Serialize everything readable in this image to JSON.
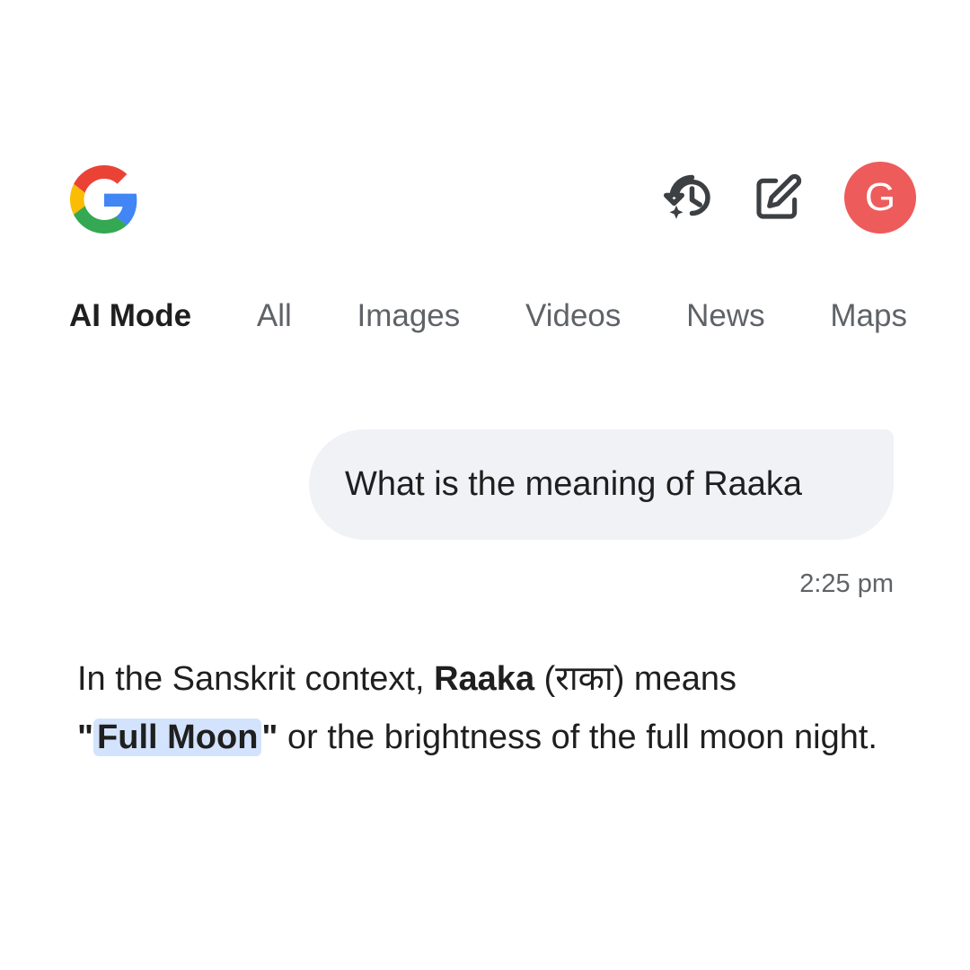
{
  "header": {
    "logo_icon": "google-g-logo",
    "history_icon": "history-sparkle-icon",
    "edit_icon": "new-chat-edit-icon",
    "avatar_letter": "G",
    "avatar_color": "#ee5b5b"
  },
  "tabs": [
    {
      "label": "AI Mode",
      "active": true
    },
    {
      "label": "All",
      "active": false
    },
    {
      "label": "Images",
      "active": false
    },
    {
      "label": "Videos",
      "active": false
    },
    {
      "label": "News",
      "active": false
    },
    {
      "label": "Maps",
      "active": false
    }
  ],
  "chat": {
    "user_query": "What is the meaning of Raaka",
    "timestamp": "2:25 pm",
    "answer": {
      "part1": "In the Sanskrit context, ",
      "term": "Raaka",
      "part2": " (राका) means ",
      "quote_open": "\"",
      "highlight": "Full Moon",
      "quote_close": "\"",
      "part3": " or the brightness of the full moon night."
    }
  },
  "colors": {
    "highlight": "#d3e3fd",
    "bubble": "#f0f2f6",
    "tab_inactive": "#5f6368"
  }
}
